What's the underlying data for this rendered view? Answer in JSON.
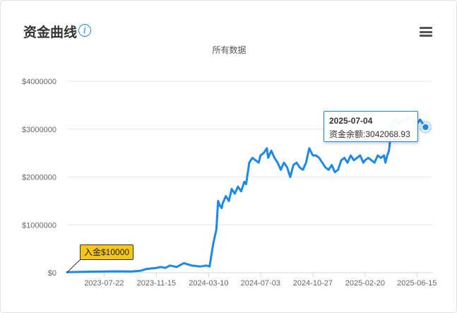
{
  "header": {
    "title": "资金曲线",
    "info_icon": "info-icon",
    "menu_icon": "hamburger-menu-icon"
  },
  "chart_data": {
    "type": "line",
    "title": "资金曲线",
    "subtitle": "所有数据",
    "color": "#1e88e5",
    "xlabel": "",
    "ylabel": "",
    "ylim": [
      0,
      4000000
    ],
    "yticks": [
      0,
      1000000,
      2000000,
      3000000,
      4000000
    ],
    "ytick_labels": [
      "$0",
      "$1000000",
      "$2000000",
      "$3000000",
      "$4000000"
    ],
    "xlim": [
      "2023-05-01",
      "2025-07-19"
    ],
    "xtick_labels": [
      "2023-07-22",
      "2023-11-15",
      "2024-03-10",
      "2024-07-03",
      "2024-10-27",
      "2025-02-20",
      "2025-06-15"
    ],
    "grid": true,
    "series": [
      {
        "x": [
          "2023-05-01",
          "2023-05-15",
          "2023-06-15",
          "2023-07-22",
          "2023-08-20",
          "2023-09-20",
          "2023-10-10",
          "2023-10-25",
          "2023-11-15",
          "2023-11-25",
          "2023-12-05",
          "2023-12-15",
          "2023-12-30",
          "2024-01-15",
          "2024-02-01",
          "2024-02-20",
          "2024-03-05",
          "2024-03-12",
          "2024-03-20",
          "2024-03-27",
          "2024-03-31",
          "2024-04-04",
          "2024-04-08",
          "2024-04-10",
          "2024-04-17",
          "2024-04-24",
          "2024-04-30",
          "2024-05-07",
          "2024-05-14",
          "2024-05-21",
          "2024-05-28",
          "2024-06-01",
          "2024-06-08",
          "2024-06-15",
          "2024-06-22",
          "2024-06-29",
          "2024-07-03",
          "2024-07-10",
          "2024-07-17",
          "2024-07-20",
          "2024-07-27",
          "2024-08-03",
          "2024-08-10",
          "2024-08-17",
          "2024-08-24",
          "2024-08-31",
          "2024-09-07",
          "2024-09-14",
          "2024-09-21",
          "2024-09-28",
          "2024-10-05",
          "2024-10-12",
          "2024-10-19",
          "2024-10-27",
          "2024-11-03",
          "2024-11-10",
          "2024-11-17",
          "2024-11-24",
          "2024-12-01",
          "2024-12-08",
          "2024-12-15",
          "2024-12-22",
          "2024-12-29",
          "2025-01-05",
          "2025-01-12",
          "2025-01-19",
          "2025-01-26",
          "2025-02-02",
          "2025-02-09",
          "2025-02-16",
          "2025-02-20",
          "2025-02-27",
          "2025-03-06",
          "2025-03-13",
          "2025-03-20",
          "2025-03-27",
          "2025-04-03",
          "2025-04-06",
          "2025-04-10",
          "2025-04-14",
          "2025-04-18",
          "2025-04-22",
          "2025-04-29",
          "2025-05-06",
          "2025-05-13",
          "2025-05-20",
          "2025-05-27",
          "2025-06-03",
          "2025-06-10",
          "2025-06-15",
          "2025-06-22",
          "2025-06-29",
          "2025-07-04"
        ],
        "y": [
          10000,
          15000,
          20000,
          25000,
          30000,
          25000,
          40000,
          80000,
          100000,
          120000,
          100000,
          150000,
          120000,
          200000,
          150000,
          130000,
          150000,
          130000,
          600000,
          900000,
          1500000,
          1400000,
          1350000,
          1450000,
          1600000,
          1500000,
          1750000,
          1650000,
          1800000,
          1700000,
          1900000,
          1850000,
          2300000,
          2400000,
          2350000,
          2300000,
          2450000,
          2500000,
          2600000,
          2400000,
          2550000,
          2400000,
          2300000,
          2150000,
          2300000,
          2200000,
          2000000,
          2250000,
          2300000,
          2200000,
          2150000,
          2300000,
          2600000,
          2450000,
          2450000,
          2400000,
          2300000,
          2200000,
          2150000,
          2250000,
          2100000,
          2150000,
          2350000,
          2400000,
          2300000,
          2450000,
          2350000,
          2400000,
          2450000,
          2300000,
          2350000,
          2400000,
          2350000,
          2300000,
          2450000,
          2400000,
          2450000,
          2300000,
          2450000,
          2550000,
          2900000,
          3150000,
          3200000,
          3100000,
          3200000,
          3150000,
          3250000,
          3200000,
          3150000,
          3100000,
          3200000,
          3100000,
          3042068.93
        ]
      }
    ],
    "annotations": {
      "deposit_label": "入金$10000",
      "deposit_date": "2023-05-01",
      "tooltip_date": "2025-07-04",
      "tooltip_label": "资金余额:",
      "tooltip_value": "3042068.93",
      "tooltip_value_number": 3042068.93
    }
  }
}
